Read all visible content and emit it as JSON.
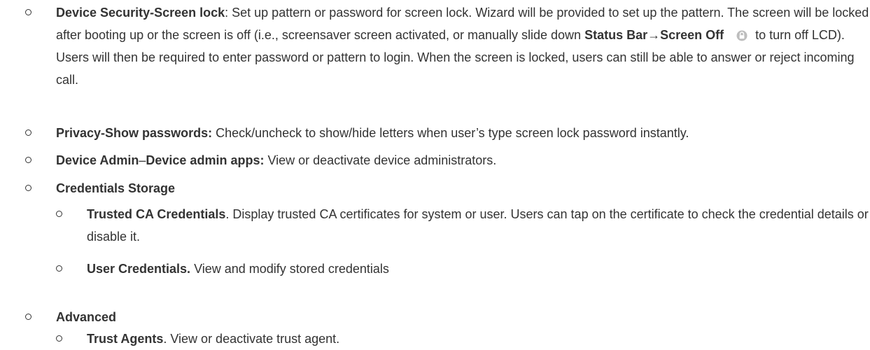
{
  "items": [
    {
      "label": "Device Security-Screen lock",
      "text_a": ": Set up pattern or password for screen lock. Wizard will be provided to set up the pattern. The screen will be locked after booting up or the screen is off (i.e., screensaver screen activated, or manually slide down ",
      "bold_b": "Status Bar→Screen Off",
      "icon": "lock-icon",
      "text_c": " to turn off LCD). Users will then be required to enter password or pattern to login. When the screen is locked, users can still be able to answer or reject incoming call."
    },
    {
      "label": "Privacy-Show passwords:",
      "text": " Check/uncheck to show/hide letters when user’s type screen lock password instantly."
    },
    {
      "label_a": "Device Admin",
      "dash": "–",
      "label_b": "Device admin apps:",
      "text": " View or deactivate device administrators."
    },
    {
      "label": "Credentials Storage",
      "children": [
        {
          "label": "Trusted CA Credentials",
          "text": ". Display trusted CA certificates for system or user. Users can tap on the certificate to check the credential details or disable it."
        },
        {
          "label": "User Credentials.",
          "text": " View and modify stored credentials"
        }
      ]
    },
    {
      "label": "Advanced",
      "children": [
        {
          "label": "Trust Agents",
          "text": ". View or deactivate trust agent."
        }
      ]
    }
  ],
  "colors": {
    "text": "#333333",
    "icon": "#bbbbbb"
  }
}
